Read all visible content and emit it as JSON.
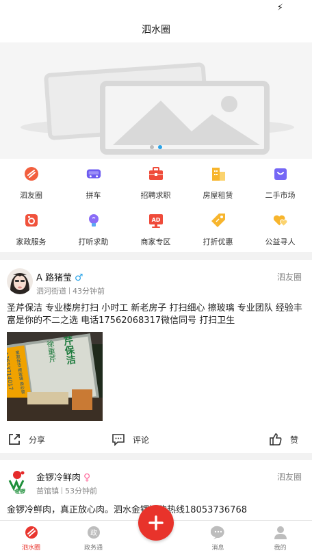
{
  "status_bar": {
    "icon": "bolt-icon"
  },
  "header": {
    "title": "泗水圈"
  },
  "banner": {
    "image": "placeholder-image",
    "page_count": 2,
    "active_page": 2
  },
  "categories": [
    {
      "label": "泗友圈",
      "icon": "circle-tag-icon",
      "color": "#f25f3e"
    },
    {
      "label": "拼车",
      "icon": "car-icon",
      "color": "#6e5cf0"
    },
    {
      "label": "招聘求职",
      "icon": "briefcase-icon",
      "color": "#ef4b3a"
    },
    {
      "label": "房屋租赁",
      "icon": "building-icon",
      "color": "#f7b52d"
    },
    {
      "label": "二手市场",
      "icon": "shopping-bag-icon",
      "color": "#7567f5"
    },
    {
      "label": "家政服务",
      "icon": "housekeeping-icon",
      "color": "#f0523c"
    },
    {
      "label": "打听求助",
      "icon": "bulb-icon",
      "color": "#8a6cf7"
    },
    {
      "label": "商家专区",
      "icon": "ad-icon",
      "color": "#ef4b3a"
    },
    {
      "label": "打折优惠",
      "icon": "discount-tag-icon",
      "color": "#f7b52d"
    },
    {
      "label": "公益寻人",
      "icon": "hearts-icon",
      "color": "#f7b52d"
    }
  ],
  "posts": [
    {
      "author": "A 路猪莹",
      "gender_symbol": "♂",
      "location": "泗河街道",
      "time": "43分钟前",
      "circle": "泗友圈",
      "content": "圣芹保洁 专业楼房打扫 小时工 新老房子 打扫细心 擦玻璃 专业团队 经验丰富是你的不二之选 电话17562068317微信同号 打扫卫生",
      "photo": {
        "sign_text": "芹保洁",
        "sign_sub": "徐重芹",
        "phone": "13653714017",
        "sign_extra": "家政保洁 擦玻璃 换纱窗"
      }
    },
    {
      "author": "金锣冷鲜肉",
      "gender_symbol": "♀",
      "location": "苗馆镇",
      "time": "53分钟前",
      "circle": "泗友圈",
      "avatar_logo": "金锣",
      "content": "金锣冷鲜肉，真正放心肉。泗水金锣订购热线18053736768"
    }
  ],
  "post_actions": {
    "share": "分享",
    "comment": "评论",
    "like": "赞"
  },
  "tabbar": {
    "items": [
      {
        "label": "泗水圈",
        "icon": "sishui-circle-icon",
        "active": true
      },
      {
        "label": "政务通",
        "icon": "government-icon",
        "active": false
      },
      {
        "label": "消息",
        "icon": "message-icon",
        "active": false
      },
      {
        "label": "我的",
        "icon": "profile-icon",
        "active": false
      }
    ],
    "publish_button": "plus-icon"
  },
  "colors": {
    "accent": "#e8332b",
    "indicator": "#2aa3e8"
  }
}
